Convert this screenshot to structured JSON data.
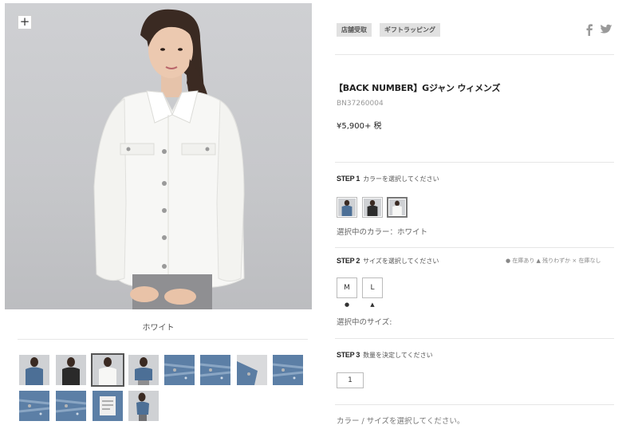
{
  "main_image": {
    "zoom_label": "+",
    "color_caption": "ホワイト"
  },
  "thumbnails": [
    {
      "row": 1,
      "col": 1,
      "kind": "model-denim"
    },
    {
      "row": 1,
      "col": 2,
      "kind": "model-black"
    },
    {
      "row": 1,
      "col": 3,
      "kind": "model-white",
      "selected": true
    },
    {
      "row": 1,
      "col": 4,
      "kind": "model-denim-back"
    },
    {
      "row": 1,
      "col": 5,
      "kind": "denim-detail"
    },
    {
      "row": 1,
      "col": 6,
      "kind": "denim-detail"
    },
    {
      "row": 1,
      "col": 7,
      "kind": "denim-sleeve"
    },
    {
      "row": 1,
      "col": 8,
      "kind": "denim-detail"
    },
    {
      "row": 2,
      "col": 1,
      "kind": "denim-detail"
    },
    {
      "row": 2,
      "col": 2,
      "kind": "denim-detail"
    },
    {
      "row": 2,
      "col": 3,
      "kind": "denim-label"
    },
    {
      "row": 2,
      "col": 4,
      "kind": "model-denim-side"
    }
  ],
  "tags": [
    "店舗受取",
    "ギフトラッピング"
  ],
  "share": {
    "facebook_icon": "facebook-icon",
    "twitter_icon": "twitter-icon"
  },
  "product": {
    "title": "【BACK NUMBER】Gジャン ウィメンズ",
    "code": "BN37260004",
    "price": "¥5,900+ 税"
  },
  "step1": {
    "num": "STEP 1",
    "text": "カラーを選択してください",
    "selected_color": "選択中のカラー：ホワイト",
    "swatches": [
      {
        "name": "denim",
        "color": "#4c6f96"
      },
      {
        "name": "black",
        "color": "#2c2c2c"
      },
      {
        "name": "white",
        "color": "#f2f2f2",
        "selected": true
      }
    ]
  },
  "step2": {
    "num": "STEP 2",
    "text": "サイズを選択してください",
    "legend": "● 在庫あり ▲ 残りわずか × 在庫なし",
    "sizes": [
      {
        "label": "M",
        "stock": "●"
      },
      {
        "label": "L",
        "stock": "▲"
      }
    ],
    "selected_size": "選択中のサイズ:"
  },
  "step3": {
    "num": "STEP 3",
    "text": "数量を決定してください",
    "quantity": "1"
  },
  "footer_note": "カラー / サイズを選択してください。",
  "colors": {
    "tag_bg": "#e1e1e1",
    "divider": "#e6e6e6",
    "denim": "#4c6f96"
  }
}
